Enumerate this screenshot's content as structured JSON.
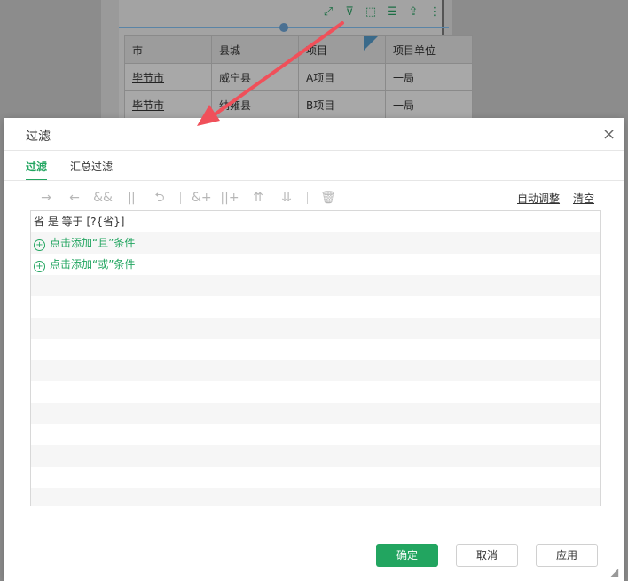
{
  "background": {
    "toolbar_icons": [
      "expand-icon",
      "filter-icon",
      "select-icon",
      "list-icon",
      "export-icon",
      "more-icon"
    ],
    "table": {
      "headers": [
        "市",
        "县城",
        "项目",
        "项目单位"
      ],
      "rows": [
        [
          "毕节市",
          "威宁县",
          "A项目",
          "一局"
        ],
        [
          "毕节市",
          "纳雍县",
          "B项目",
          "一局"
        ]
      ]
    }
  },
  "dialog": {
    "title": "过滤",
    "close_icon": "×",
    "tabs": [
      {
        "label": "过滤",
        "active": true
      },
      {
        "label": "汇总过滤",
        "active": false
      }
    ],
    "toolbar": {
      "icons": [
        "→",
        "←",
        "&&",
        "||",
        "⮌",
        "&+",
        "||+",
        "⇈",
        "⇊",
        "🗑"
      ],
      "auto_adjust": "自动调整",
      "clear": "清空"
    },
    "condition": "省 是 等于 [?{省}]",
    "add_and": "点击添加“且”条件",
    "add_or": "点击添加“或”条件",
    "buttons": {
      "ok": "确定",
      "cancel": "取消",
      "apply": "应用"
    }
  },
  "colors": {
    "accent": "#22a560",
    "arrow": "#f0505a"
  }
}
